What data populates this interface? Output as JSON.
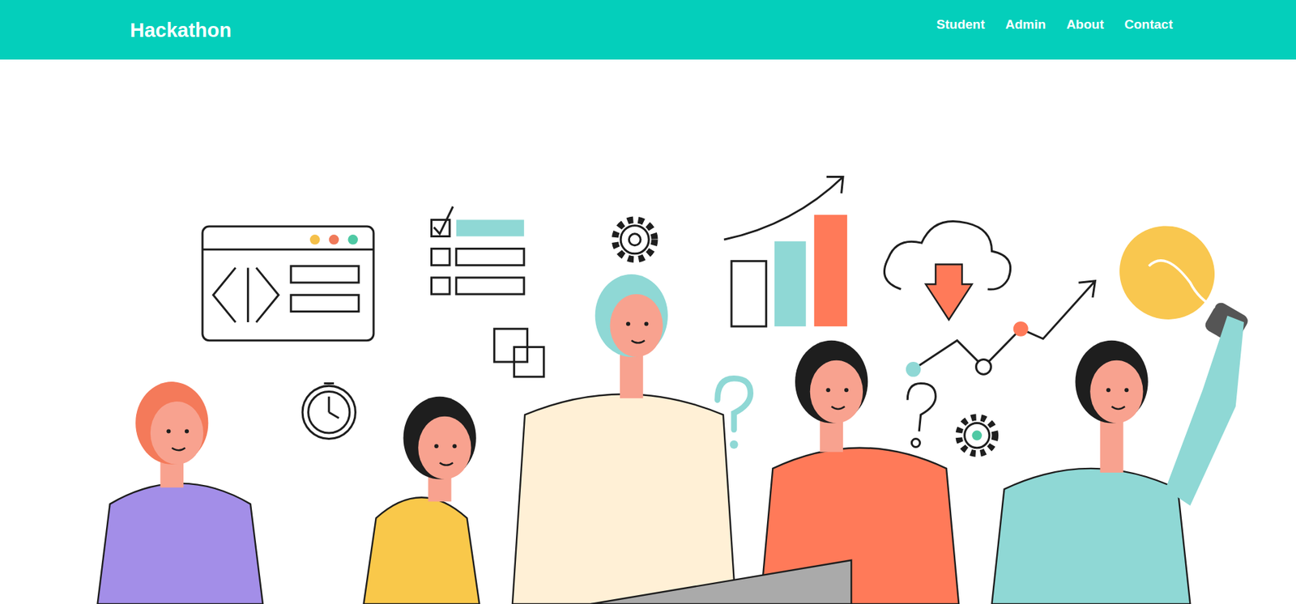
{
  "navbar": {
    "brand": "Hackathon",
    "links": [
      "Student",
      "Admin",
      "About",
      "Contact"
    ]
  }
}
